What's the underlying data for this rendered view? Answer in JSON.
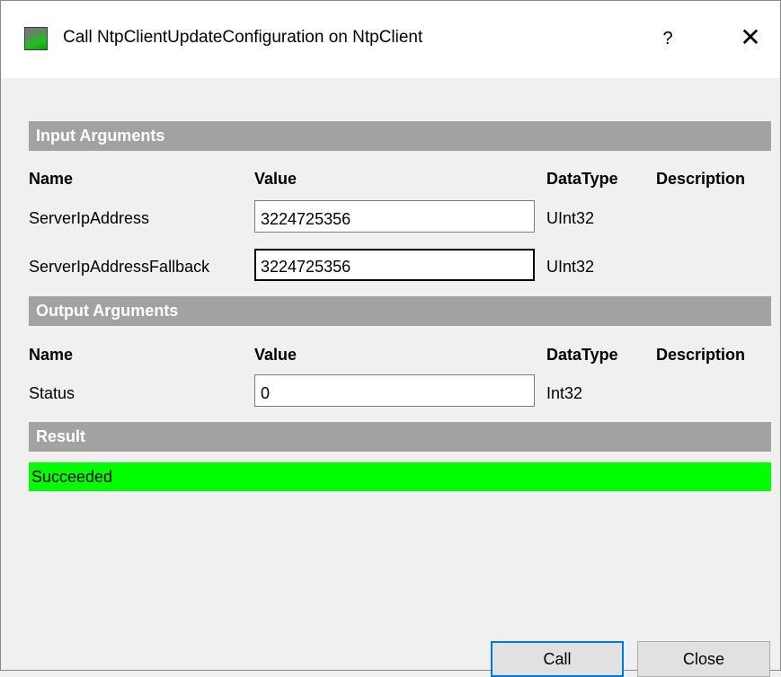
{
  "window": {
    "title": "Call NtpClientUpdateConfiguration on NtpClient",
    "help_glyph": "?",
    "close_glyph": "✕"
  },
  "input_section": {
    "header": "Input Arguments",
    "columns": {
      "name": "Name",
      "value": "Value",
      "datatype": "DataType",
      "description": "Description"
    },
    "rows": [
      {
        "name": "ServerIpAddress",
        "value": "3224725356",
        "datatype": "UInt32"
      },
      {
        "name": "ServerIpAddressFallback",
        "value": "3224725356",
        "datatype": "UInt32"
      }
    ]
  },
  "output_section": {
    "header": "Output Arguments",
    "columns": {
      "name": "Name",
      "value": "Value",
      "datatype": "DataType",
      "description": "Description"
    },
    "rows": [
      {
        "name": "Status",
        "value": "0",
        "datatype": "Int32"
      }
    ]
  },
  "result_section": {
    "header": "Result",
    "status_text": "Succeeded",
    "status_color": "#00ff00"
  },
  "buttons": {
    "call": "Call",
    "close": "Close"
  },
  "icons": {
    "app": "ntp-app-icon",
    "help": "help-icon",
    "close": "close-icon"
  }
}
